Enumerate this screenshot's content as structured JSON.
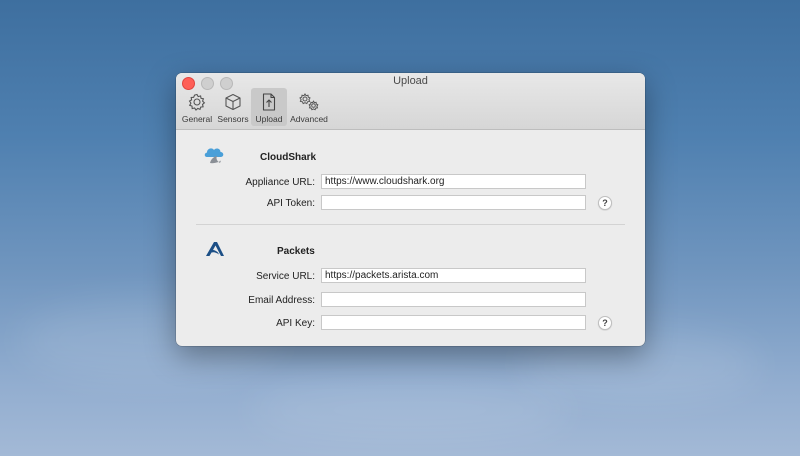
{
  "window": {
    "title": "Upload"
  },
  "toolbar": {
    "items": [
      {
        "label": "General",
        "icon": "gear-icon"
      },
      {
        "label": "Sensors",
        "icon": "cube-icon"
      },
      {
        "label": "Upload",
        "icon": "upload-document-icon",
        "selected": true
      },
      {
        "label": "Advanced",
        "icon": "gears-icon"
      }
    ]
  },
  "cloudshark": {
    "title": "CloudShark",
    "appliance_url_label": "Appliance URL:",
    "appliance_url_value": "https://www.cloudshark.org",
    "api_token_label": "API Token:",
    "api_token_value": "",
    "help": "?"
  },
  "packets": {
    "title": "Packets",
    "service_url_label": "Service URL:",
    "service_url_value": "https://packets.arista.com",
    "email_label": "Email Address:",
    "email_value": "",
    "api_key_label": "API Key:",
    "api_key_value": "",
    "help": "?"
  },
  "colors": {
    "close": "#fe5f57",
    "cloudshark_blue": "#4a9fd8",
    "arista_blue": "#1c4f86"
  }
}
